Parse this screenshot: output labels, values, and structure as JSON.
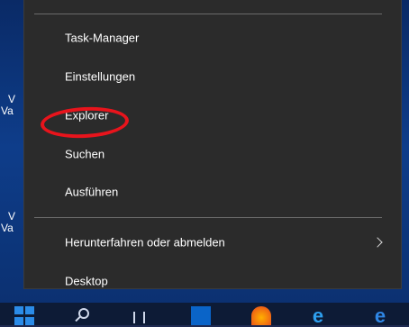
{
  "menu": {
    "items": [
      {
        "label": "Task-Manager"
      },
      {
        "label": "Einstellungen"
      },
      {
        "label": "Explorer"
      },
      {
        "label": "Suchen"
      },
      {
        "label": "Ausführen"
      },
      {
        "label": "Herunterfahren oder abmelden"
      },
      {
        "label": "Desktop"
      }
    ]
  },
  "desktop": {
    "fragments": [
      "V",
      "Va",
      "V",
      "Va"
    ]
  },
  "taskbar": {
    "icons": [
      "start-icon",
      "search-icon",
      "task-view-icon",
      "outlook-icon",
      "firefox-icon",
      "internet-explorer-icon",
      "edge-icon"
    ]
  },
  "annotation": {
    "color": "#e8141c",
    "target": "Explorer"
  }
}
